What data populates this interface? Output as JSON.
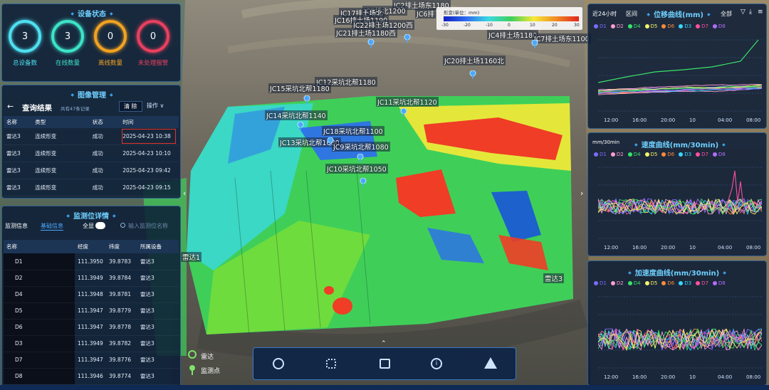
{
  "device_status": {
    "title": "设备状态",
    "gauges": [
      {
        "value": "3",
        "label": "总设备数",
        "color": "#4ee0f0"
      },
      {
        "value": "3",
        "label": "在线数量",
        "color": "#3de3c8"
      },
      {
        "value": "0",
        "label": "离线数量",
        "color": "#f2a321"
      },
      {
        "value": "0",
        "label": "未处理报警",
        "color": "#e8405f"
      }
    ]
  },
  "image_mgmt": {
    "title": "图像管理",
    "back": "←",
    "query_title": "查询结果",
    "count": "共有47条记录",
    "clear": "清 除",
    "ops": "操作 ∨",
    "columns": [
      "名称",
      "类型",
      "状态",
      "时间"
    ],
    "rows": [
      [
        "雷达3",
        "连续形变",
        "成功",
        "2025-04-23 10:38"
      ],
      [
        "雷达3",
        "连续形变",
        "成功",
        "2025-04-23 10:10"
      ],
      [
        "雷达3",
        "连续形变",
        "成功",
        "2025-04-23 09:42"
      ],
      [
        "雷达3",
        "连续形变",
        "成功",
        "2025-04-23 09:15"
      ]
    ]
  },
  "monitor": {
    "title": "监测位详情",
    "tab1": "监测信息",
    "tab2": "基础信息",
    "all_label": "全显",
    "search_placeholder": "输入监测位名称",
    "columns": [
      "名称",
      "经度",
      "纬度",
      "所属设备"
    ],
    "rows": [
      [
        "D1",
        "111.3950",
        "39.8783",
        "雷达3"
      ],
      [
        "D2",
        "111.3949",
        "39.8784",
        "雷达3"
      ],
      [
        "D4",
        "111.3948",
        "39.8781",
        "雷达3"
      ],
      [
        "D5",
        "111.3947",
        "39.8779",
        "雷达3"
      ],
      [
        "D6",
        "111.3947",
        "39.8778",
        "雷达3"
      ],
      [
        "D3",
        "111.3949",
        "39.8782",
        "雷达3"
      ],
      [
        "D7",
        "111.3947",
        "39.8776",
        "雷达3"
      ],
      [
        "D8",
        "111.3946",
        "39.8774",
        "雷达3"
      ]
    ]
  },
  "colorbar": {
    "title": "形变(单位：mm)",
    "ticks": [
      "-30",
      "-20",
      "-10",
      "0",
      "10",
      "20",
      "30"
    ]
  },
  "map_labels": [
    "JC2排土场东1180",
    "JC8排北1200",
    "JC6排",
    "JC17排土场北",
    "JC16排土场1190",
    "JC22排土场1200西",
    "JC21排土场1180西",
    "JC4排土场1180",
    "JC7排土场东1100",
    "JC20排土场1160北",
    "JC12采坑北帮1180",
    "JC15采坑北帮1180",
    "JC11采坑北帮1120",
    "JC14采坑北帮1140",
    "JC18采坑北帮1100",
    "JC13采坑北帮1080",
    "JC9采坑北帮1080",
    "JC10采坑北帮1050",
    "雷达1",
    "雷达3"
  ],
  "map_legend": {
    "radar": "雷达",
    "point": "监测点"
  },
  "toolbar": {
    "icons": [
      "history-icon",
      "grid-icon",
      "map-icon",
      "info-icon",
      "warning-icon"
    ],
    "collapse": "⌃"
  },
  "displacement": {
    "title": "位移曲线(mm)",
    "range": "近24小时",
    "interval": "区间",
    "scope": "全部",
    "legend": [
      "D1",
      "D2",
      "D4",
      "D5",
      "D6",
      "D3",
      "D7",
      "D8"
    ],
    "x_ticks": [
      "12:00",
      "16:00",
      "20:00",
      "10",
      "04:00",
      "08:00"
    ]
  },
  "velocity": {
    "title": "速度曲线(mm/30min)",
    "unit": "mm/30min",
    "legend": [
      "D1",
      "D2",
      "D4",
      "D5",
      "D6",
      "D3",
      "D7",
      "D8"
    ],
    "x_ticks": [
      "12:00",
      "16:00",
      "20:00",
      "10",
      "04:00",
      "08:00"
    ]
  },
  "acceleration": {
    "title": "加速度曲线(mm/30min)",
    "legend": [
      "D1",
      "D2",
      "D4",
      "D5",
      "D6",
      "D3",
      "D7",
      "D8"
    ],
    "x_ticks": [
      "12:00",
      "16:00",
      "20:00",
      "10",
      "04:00",
      "08:00"
    ]
  },
  "series_colors": [
    "#7b6cff",
    "#ff9ed1",
    "#39e36b",
    "#f5f36a",
    "#ff8a3d",
    "#3ad7ff",
    "#ff4fa3",
    "#b26cff"
  ]
}
